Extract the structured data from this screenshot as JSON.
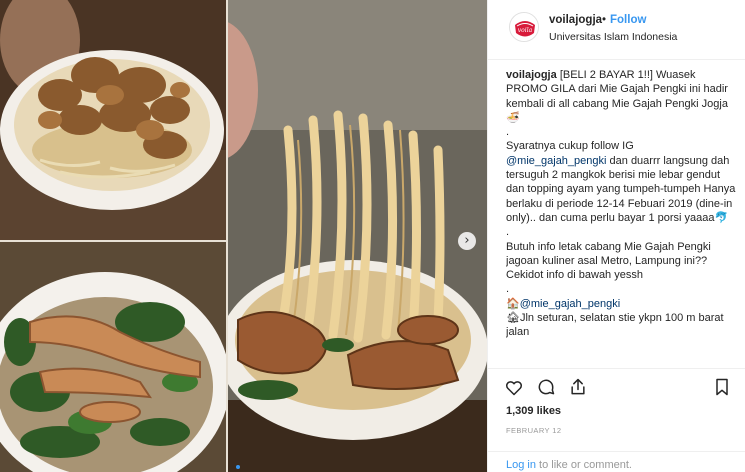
{
  "post": {
    "username": "voilajogja",
    "separator": "•",
    "follow_label": "Follow",
    "location": "Universitas Islam Indonesia",
    "avatar_text": "voila"
  },
  "caption": {
    "line1_rest": "[BELI 2 BAYAR 1!!] Wuasek PROMO GILA dari Mie Gajah Pengki ini hadir kembali di all cabang Mie Gajah Pengki Jogja🍜",
    "dot1": ".",
    "p2_a": "Syaratnya cukup follow IG",
    "p2_mention": "@mie_gajah_pengki",
    "p2_b": "dan duarrr langsung dah tersuguh 2 mangkok berisi mie lebar gendut dan topping ayam yang tumpeh-tumpeh Hanya berlaku di periode 12-14 Febuari 2019 (dine-in only).. dan cuma perlu bayar 1 porsi yaaaa🐬",
    "dot2": ".",
    "p3": "Butuh info letak cabang Mie Gajah Pengki jagoan kuliner asal Metro, Lampung ini?? Cekidot info di bawah yessh",
    "dot3": ".",
    "p4_icon": "🏠",
    "p4_mention": "@mie_gajah_pengki",
    "p5_icon": "🏚",
    "p5_text": "Jln seturan, selatan stie ykpn 100 m barat jalan"
  },
  "engagement": {
    "likes": "1,309 likes",
    "date": "FEBRUARY 12",
    "login_link": "Log in",
    "login_rest": " to like or comment."
  },
  "icons": {
    "like": "heart-icon",
    "comment": "comment-bubble-icon",
    "share": "share-icon",
    "save": "bookmark-icon",
    "next": "chevron-right-icon"
  },
  "colors": {
    "link_blue": "#3897f0",
    "mention_blue": "#003569",
    "muted": "#999999"
  }
}
